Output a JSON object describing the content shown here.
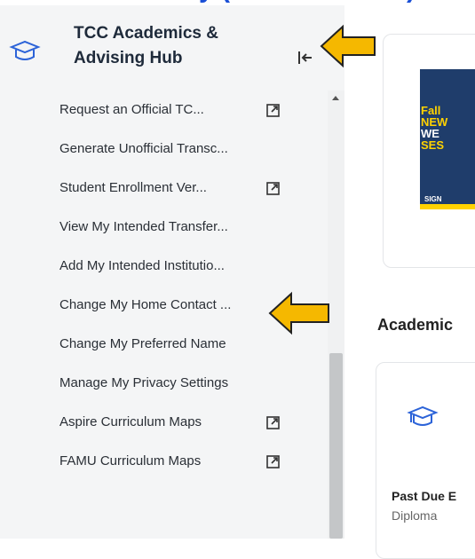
{
  "page": {
    "top_banner_text": "y (",
    "top_banner_tail": ")"
  },
  "sidebar": {
    "title_line1": "TCC Academics &",
    "title_line2": "Advising Hub",
    "collapse_icon": "collapse-left-icon",
    "items": [
      {
        "label": "Request an Official TC...",
        "external": true
      },
      {
        "label": "Generate Unofficial Transc...",
        "external": false
      },
      {
        "label": "Student Enrollment Ver...",
        "external": true
      },
      {
        "label": "View My Intended Transfer...",
        "external": false
      },
      {
        "label": "Add My Intended Institutio...",
        "external": false
      },
      {
        "label": "Change My Home Contact ...",
        "external": false
      },
      {
        "label": "Change My Preferred Name",
        "external": false
      },
      {
        "label": "Manage My Privacy Settings",
        "external": false
      },
      {
        "label": "Aspire Curriculum Maps",
        "external": true
      },
      {
        "label": "FAMU Curriculum Maps",
        "external": true
      }
    ]
  },
  "promo": {
    "line1": "Fall",
    "line2": "NEW",
    "line3": "WE",
    "line4": "SES",
    "sign": "SIGN"
  },
  "main": {
    "section_title": "Academic",
    "card_title": "Past Due E",
    "card_sub": "Diploma"
  },
  "colors": {
    "accent": "#1a4fd6",
    "arrow_fill": "#f5b800",
    "sidebar_bg": "#f4f5f6"
  }
}
